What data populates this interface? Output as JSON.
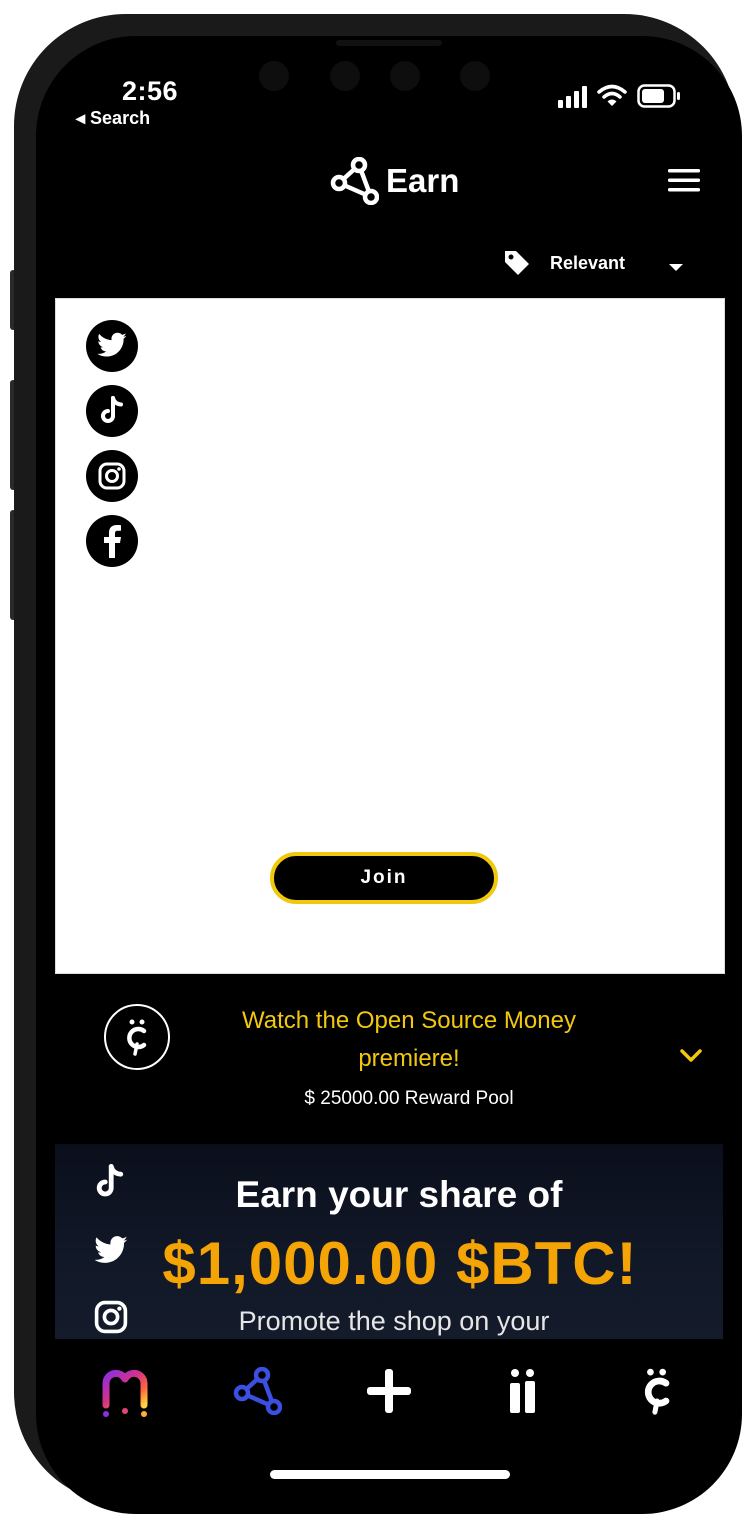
{
  "status_bar": {
    "time": "2:56",
    "back_label": "◂ Search"
  },
  "header": {
    "title": "Earn",
    "menu_icon": "hamburger-menu-icon"
  },
  "sort": {
    "icon": "tag-icon",
    "selected": "Relevant"
  },
  "card": {
    "socials": [
      "twitter",
      "tiktok",
      "instagram",
      "facebook"
    ],
    "join_label": "Join",
    "join_border_color": "#f2c80f"
  },
  "campaign": {
    "title": "Watch the Open Source Money premiere!",
    "reward_pool": "$ 25000.00 Reward Pool",
    "title_color": "#f2c80f"
  },
  "banner": {
    "line1": "Earn your share of",
    "line2": "$1,000.00 $BTC!",
    "line3": "Promote the shop on your",
    "highlight_color": "#f5a406"
  },
  "bottom_nav": {
    "items": [
      "home-logo",
      "earn",
      "create",
      "info",
      "wallet"
    ],
    "active": "earn",
    "active_color": "#3b4fe0"
  }
}
